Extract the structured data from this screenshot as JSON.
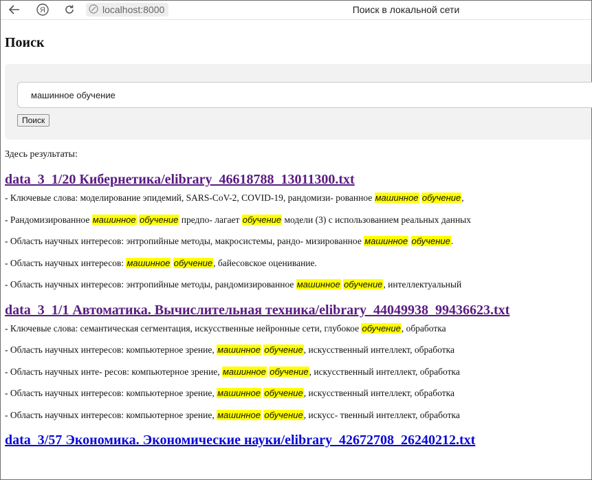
{
  "browser": {
    "back_icon": "arrow-left-icon",
    "yandex_icon": "yandex-logo-icon",
    "reload_icon": "reload-icon",
    "site_icon": "site-info-icon",
    "url": "localhost:8000",
    "tab_title": "Поиск в локальной сети"
  },
  "page": {
    "heading": "Поиск",
    "search": {
      "value": "машинное обучение",
      "button_label": "Поиск"
    },
    "results_label": "Здесь результаты:"
  },
  "results": [
    {
      "title": "data_3_1/20 Кибернетика/elibrary_46618788_13011300.txt",
      "visited": true,
      "snippets": [
        [
          "- Ключевые слова: моделирование эпидемий, SARS-CoV-2, COVID-19, рандомизи- рованное ",
          "машинное",
          " ",
          "обучение",
          ","
        ],
        [
          "- Рандомизированное ",
          "машинное",
          " ",
          "обучение",
          " предпо- лагает ",
          "обучение",
          " модели (3) с использованием реальных данных"
        ],
        [
          "- Область научных интересов: энтропийные методы, макросистемы, рандо- мизированное ",
          "машинное",
          " ",
          "обучение",
          "."
        ],
        [
          "- Область научных интересов: ",
          "машинное",
          " ",
          "обучение",
          ", байесовское оценивание."
        ],
        [
          "- Область научных интересов: энтропийные методы, рандомизированное ",
          "машинное",
          " ",
          "обучение",
          ", интеллектуальный"
        ]
      ]
    },
    {
      "title": "data_3_1/1 Автоматика. Вычислительная техника/elibrary_44049938_99436623.txt",
      "visited": true,
      "snippets": [
        [
          "- Ключевые слова: семантическая сегментация, искусственные нейронные сети, глубокое ",
          "обучение",
          ", обработка"
        ],
        [
          "- Область научных интересов: компьютерное зрение, ",
          "машинное",
          " ",
          "обучение",
          ", искусственный интеллект, обработка"
        ],
        [
          "- Область научных инте- ресов: компьютерное зрение, ",
          "машинное",
          " ",
          "обучение",
          ", искусственный интеллект, обработка"
        ],
        [
          "- Область научных интересов: компьютерное зрение, ",
          "машинное",
          " ",
          "обучение",
          ", искусственный интеллект, обработка"
        ],
        [
          "- Область научных интересов: компьютерное зрение, ",
          "машинное",
          " ",
          "обучение",
          ", искусс- твенный интеллект, обработка"
        ]
      ]
    },
    {
      "title": "data_3/57 Экономика. Экономические науки/elibrary_42672708_26240212.txt",
      "visited": false,
      "snippets": []
    }
  ],
  "colors": {
    "highlight": "#ffff00",
    "link_visited": "#5a1b82",
    "link_unvisited": "#0a0ad6",
    "panel_bg": "#f2f2f2"
  }
}
